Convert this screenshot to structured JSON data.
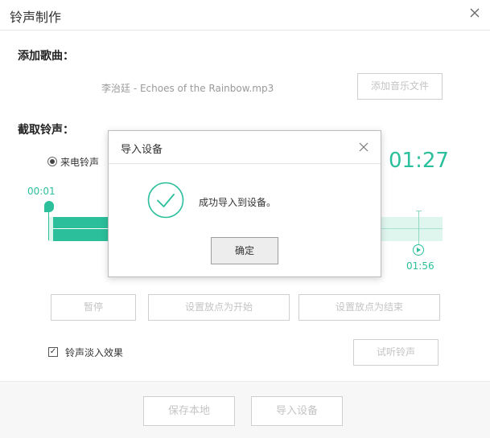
{
  "window": {
    "title": "铃声制作"
  },
  "add_song": {
    "label": "添加歌曲：",
    "filename": "李治廷 - Echoes of the Rainbow.mp3",
    "add_button": "添加音乐文件"
  },
  "clip": {
    "label": "截取铃声：",
    "mode_label": "来电铃声",
    "total_time": "01:27",
    "start_time": "00:01",
    "end_time": "01:56"
  },
  "controls": {
    "pause": "暂停",
    "set_start": "设置放点为开始",
    "set_end": "设置放点为结束",
    "preview": "试听铃声",
    "fade_label": "铃声淡入效果",
    "fade_checked": "✓"
  },
  "footer": {
    "save_local": "保存本地",
    "import_device": "导入设备"
  },
  "dialog": {
    "title": "导入设备",
    "message": "成功导入到设备。",
    "ok": "确定"
  },
  "colors": {
    "accent": "#2bbf9b",
    "accent_light": "#dff6ef"
  }
}
